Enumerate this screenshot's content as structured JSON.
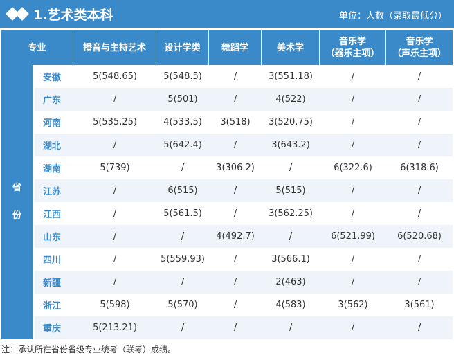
{
  "header": {
    "title": "1.艺术类本科",
    "unit": "单位：人数（录取最低分）"
  },
  "columns": {
    "major": "专业",
    "c1": "播音与主持艺术",
    "c2": "设计学类",
    "c3": "舞蹈学",
    "c4": "美术学",
    "c5a": "音乐学",
    "c5b": "（器乐主项）",
    "c6a": "音乐学",
    "c6b": "（声乐主项）"
  },
  "side_label": {
    "a": "省",
    "b": "份"
  },
  "rows": [
    {
      "province": "安徽",
      "c1": "5(548.65)",
      "c2": "5(548.5)",
      "c3": "/",
      "c4": "3(551.18)",
      "c5": "/",
      "c6": "/"
    },
    {
      "province": "广东",
      "c1": "/",
      "c2": "5(501)",
      "c3": "/",
      "c4": "4(522)",
      "c5": "/",
      "c6": "/"
    },
    {
      "province": "河南",
      "c1": "5(535.25)",
      "c2": "4(533.5)",
      "c3": "3(518)",
      "c4": "3(520.75)",
      "c5": "/",
      "c6": "/"
    },
    {
      "province": "湖北",
      "c1": "/",
      "c2": "5(642.4)",
      "c3": "/",
      "c4": "3(643.2)",
      "c5": "/",
      "c6": "/"
    },
    {
      "province": "湖南",
      "c1": "5(739)",
      "c2": "/",
      "c3": "3(306.2)",
      "c4": "/",
      "c5": "6(322.6)",
      "c6": "6(318.6)"
    },
    {
      "province": "江苏",
      "c1": "/",
      "c2": "6(515)",
      "c3": "/",
      "c4": "5(515)",
      "c5": "/",
      "c6": "/"
    },
    {
      "province": "江西",
      "c1": "/",
      "c2": "5(561.5)",
      "c3": "/",
      "c4": "3(562.25)",
      "c5": "/",
      "c6": "/"
    },
    {
      "province": "山东",
      "c1": "/",
      "c2": "/",
      "c3": "4(492.7)",
      "c4": "/",
      "c5": "6(521.99)",
      "c6": "6(520.68)"
    },
    {
      "province": "四川",
      "c1": "/",
      "c2": "5(559.93)",
      "c3": "/",
      "c4": "3(566.1)",
      "c5": "/",
      "c6": "/"
    },
    {
      "province": "新疆",
      "c1": "/",
      "c2": "/",
      "c3": "/",
      "c4": "2(463)",
      "c5": "/",
      "c6": "/"
    },
    {
      "province": "浙江",
      "c1": "5(598)",
      "c2": "5(570)",
      "c3": "/",
      "c4": "4(583)",
      "c5": "3(562)",
      "c6": "3(561)"
    },
    {
      "province": "重庆",
      "c1": "5(213.21)",
      "c2": "/",
      "c3": "/",
      "c4": "/",
      "c5": "/",
      "c6": "/"
    }
  ],
  "note": "注：承认所在省份省级专业统考（联考）成绩。",
  "colors": {
    "primary": "#3a89c9",
    "stripe": "#eef4fa"
  }
}
